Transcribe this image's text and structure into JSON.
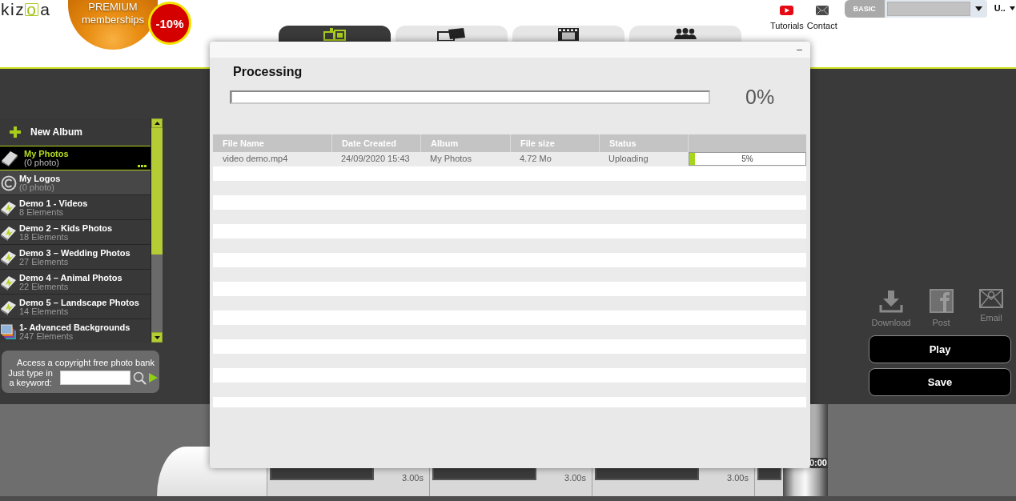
{
  "header": {
    "logo": "kizoa",
    "promo": {
      "text": "PREMIUM memberships",
      "discount": "-10%"
    },
    "tabs": [
      {
        "selected": true
      },
      {
        "selected": false
      },
      {
        "selected": false
      },
      {
        "selected": false
      }
    ],
    "links": [
      {
        "label": "Tutorials"
      },
      {
        "label": "Contact"
      }
    ],
    "account": {
      "plan": "BASIC",
      "user": "U.."
    }
  },
  "sidebar": {
    "new_album": "New Album",
    "albums": [
      {
        "kind": "book",
        "title": "My Photos",
        "subtitle": "(0 photo)",
        "selected": true
      },
      {
        "kind": "logo",
        "title": "My Logos",
        "subtitle": "(0 photo)",
        "selected": false
      },
      {
        "kind": "demo",
        "title": "Demo 1 - Videos",
        "subtitle": "8 Elements",
        "selected": false
      },
      {
        "kind": "demo",
        "title": "Demo 2 – Kids Photos",
        "subtitle": "18 Elements",
        "selected": false
      },
      {
        "kind": "demo",
        "title": "Demo 3 – Wedding Photos",
        "subtitle": "27 Elements",
        "selected": false
      },
      {
        "kind": "demo",
        "title": "Demo 4 – Animal Photos",
        "subtitle": "22 Elements",
        "selected": false
      },
      {
        "kind": "demo",
        "title": "Demo 5 – Landscape Photos",
        "subtitle": "14 Elements",
        "selected": false
      },
      {
        "kind": "backgrounds",
        "title": "1- Advanced Backgrounds",
        "subtitle": "247 Elements",
        "selected": false
      }
    ],
    "photo_bank": {
      "title": "Access a copyright free photo bank",
      "prompt": "Just type in a keyword:"
    }
  },
  "share": [
    {
      "label": "Download"
    },
    {
      "label": "Post"
    },
    {
      "label": "Email"
    }
  ],
  "actions": [
    {
      "label": "Play"
    },
    {
      "label": "Save"
    }
  ],
  "timeline": {
    "clips": [
      {
        "duration": "3.00s"
      },
      {
        "duration": "3.00s"
      },
      {
        "duration": "3.00s"
      }
    ],
    "time": "0:00"
  },
  "dialog": {
    "title": "Processing",
    "minimize": "–",
    "progress": {
      "level": 0,
      "reading": "0%"
    },
    "table": {
      "columns": [
        "File Name",
        "Date Created",
        "Album",
        "File size",
        "Status"
      ],
      "rows": [
        {
          "file_name": "video demo.mp4",
          "date_created": "24/09/2020 15:43",
          "album": "My Photos",
          "file_size": "4.72 Mo",
          "status": "Uploading",
          "progress": {
            "level": 0.05,
            "reading": "5%"
          }
        }
      ]
    }
  }
}
